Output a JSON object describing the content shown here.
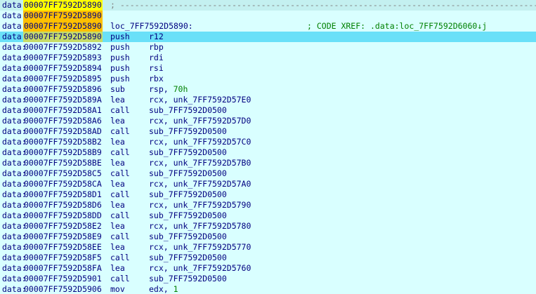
{
  "segment": "data",
  "separator": "; ------------------------------------------------------------------",
  "lines": [
    {
      "seg": "data:",
      "addr": "00007FF7592D5890",
      "hl": "yellow",
      "sep": "; ---------------------------------------------------------------------------------------------------------"
    },
    {
      "seg": "data:",
      "addr": "00007FF7592D5890",
      "hl": "orange"
    },
    {
      "seg": "data:",
      "addr": "00007FF7592D5890",
      "hl": "orange",
      "label": "loc_7FF7592D5890:",
      "comment": "; CODE XREF: .data:loc_7FF7592D6060↓j"
    },
    {
      "seg": "data:",
      "addr": "00007FF7592D5890",
      "hl": "dim",
      "selected": true,
      "mnem": "push",
      "ops": "r12"
    },
    {
      "seg": "data:",
      "addr": "00007FF7592D5892",
      "mnem": "push",
      "ops": "rbp"
    },
    {
      "seg": "data:",
      "addr": "00007FF7592D5893",
      "mnem": "push",
      "ops": "rdi"
    },
    {
      "seg": "data:",
      "addr": "00007FF7592D5894",
      "mnem": "push",
      "ops": "rsi"
    },
    {
      "seg": "data:",
      "addr": "00007FF7592D5895",
      "mnem": "push",
      "ops": "rbx"
    },
    {
      "seg": "data:",
      "addr": "00007FF7592D5896",
      "mnem": "sub",
      "ops": "rsp, ",
      "num": "70h"
    },
    {
      "seg": "data:",
      "addr": "00007FF7592D589A",
      "mnem": "lea",
      "ops": "rcx, unk_7FF7592D57E0"
    },
    {
      "seg": "data:",
      "addr": "00007FF7592D58A1",
      "mnem": "call",
      "ops": "sub_7FF7592D0500"
    },
    {
      "seg": "data:",
      "addr": "00007FF7592D58A6",
      "mnem": "lea",
      "ops": "rcx, unk_7FF7592D57D0"
    },
    {
      "seg": "data:",
      "addr": "00007FF7592D58AD",
      "mnem": "call",
      "ops": "sub_7FF7592D0500"
    },
    {
      "seg": "data:",
      "addr": "00007FF7592D58B2",
      "mnem": "lea",
      "ops": "rcx, unk_7FF7592D57C0"
    },
    {
      "seg": "data:",
      "addr": "00007FF7592D58B9",
      "mnem": "call",
      "ops": "sub_7FF7592D0500"
    },
    {
      "seg": "data:",
      "addr": "00007FF7592D58BE",
      "mnem": "lea",
      "ops": "rcx, unk_7FF7592D57B0"
    },
    {
      "seg": "data:",
      "addr": "00007FF7592D58C5",
      "mnem": "call",
      "ops": "sub_7FF7592D0500"
    },
    {
      "seg": "data:",
      "addr": "00007FF7592D58CA",
      "mnem": "lea",
      "ops": "rcx, unk_7FF7592D57A0"
    },
    {
      "seg": "data:",
      "addr": "00007FF7592D58D1",
      "mnem": "call",
      "ops": "sub_7FF7592D0500"
    },
    {
      "seg": "data:",
      "addr": "00007FF7592D58D6",
      "mnem": "lea",
      "ops": "rcx, unk_7FF7592D5790"
    },
    {
      "seg": "data:",
      "addr": "00007FF7592D58DD",
      "mnem": "call",
      "ops": "sub_7FF7592D0500"
    },
    {
      "seg": "data:",
      "addr": "00007FF7592D58E2",
      "mnem": "lea",
      "ops": "rcx, unk_7FF7592D5780"
    },
    {
      "seg": "data:",
      "addr": "00007FF7592D58E9",
      "mnem": "call",
      "ops": "sub_7FF7592D0500"
    },
    {
      "seg": "data:",
      "addr": "00007FF7592D58EE",
      "mnem": "lea",
      "ops": "rcx, unk_7FF7592D5770"
    },
    {
      "seg": "data:",
      "addr": "00007FF7592D58F5",
      "mnem": "call",
      "ops": "sub_7FF7592D0500"
    },
    {
      "seg": "data:",
      "addr": "00007FF7592D58FA",
      "mnem": "lea",
      "ops": "rcx, unk_7FF7592D5760"
    },
    {
      "seg": "data:",
      "addr": "00007FF7592D5901",
      "mnem": "call",
      "ops": "sub_7FF7592D0500"
    },
    {
      "seg": "data:",
      "addr": "00007FF7592D5906",
      "mnem": "mov",
      "ops": "edx, ",
      "num": "1"
    }
  ]
}
